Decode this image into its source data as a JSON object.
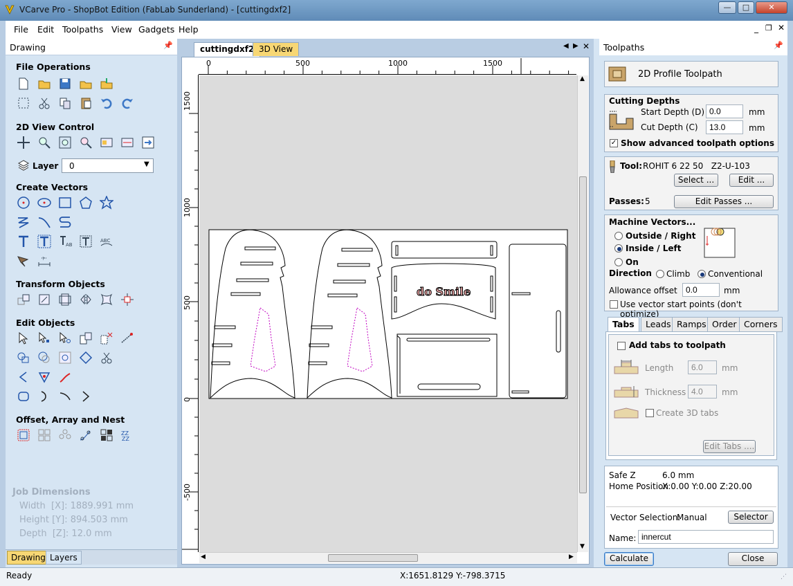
{
  "window": {
    "title": "VCarve Pro - ShopBot Edition (FabLab Sunderland) - [cuttingdxf2]"
  },
  "menu": [
    "File",
    "Edit",
    "Toolpaths",
    "View",
    "Gadgets",
    "Help"
  ],
  "left_panel": {
    "header": "Drawing",
    "sections": {
      "file_operations": "File Operations",
      "view_control": "2D View Control",
      "create_vectors": "Create Vectors",
      "transform_objects": "Transform Objects",
      "edit_objects": "Edit Objects",
      "offset_array_nest": "Offset, Array and Nest"
    },
    "layer": {
      "label": "Layer",
      "value": "0"
    },
    "job_dimensions": {
      "title": "Job Dimensions",
      "width": "Width  [X]: 1889.991 mm",
      "height": "Height [Y]: 894.503 mm",
      "depth": "Depth  [Z]: 12.0 mm"
    },
    "bottom_tabs": [
      "Drawing",
      "Layers"
    ]
  },
  "center": {
    "tabs": [
      "cuttingdxf2",
      "3D View"
    ],
    "ruler_top": [
      "0",
      "500",
      "1000",
      "1500"
    ],
    "ruler_left": [
      "1500",
      "1000",
      "500",
      "0",
      "-500"
    ],
    "design_text": "do Smile"
  },
  "right_panel": {
    "header": "Toolpaths",
    "toolpath_title": "2D Profile Toolpath",
    "cutting_depths": {
      "title": "Cutting Depths",
      "start_label": "Start Depth (D)",
      "start_value": "0.0",
      "cut_label": "Cut Depth (C)",
      "cut_value": "13.0",
      "unit": "mm",
      "advanced_label": "Show advanced toolpath options"
    },
    "tool": {
      "label": "Tool:",
      "name": "ROHIT 6 22 50   Z2-U-103",
      "select_btn": "Select ...",
      "edit_btn": "Edit ...",
      "passes_label": "Passes:",
      "passes_value": "5",
      "edit_passes_btn": "Edit Passes ..."
    },
    "machine_vectors": {
      "title": "Machine Vectors...",
      "outside": "Outside / Right",
      "inside": "Inside / Left",
      "on": "On",
      "direction_label": "Direction",
      "climb": "Climb",
      "conventional": "Conventional",
      "allowance_label": "Allowance offset",
      "allowance_value": "0.0",
      "allowance_unit": "mm",
      "start_points_label": "Use vector start points (don't optimize)"
    },
    "tabs": [
      "Tabs",
      "Leads",
      "Ramps",
      "Order",
      "Corners"
    ],
    "tabs_panel": {
      "add_tabs_label": "Add tabs to toolpath",
      "length_label": "Length",
      "length_value": "6.0",
      "thickness_label": "Thickness",
      "thickness_value": "4.0",
      "unit": "mm",
      "create_3d_label": "Create 3D tabs",
      "edit_tabs_btn": "Edit Tabs ...."
    },
    "safe_z": {
      "label": "Safe Z",
      "value": "6.0 mm"
    },
    "home": {
      "label": "Home Position",
      "value": "X:0.00 Y:0.00 Z:20.00"
    },
    "vector_selection": {
      "label": "Vector Selection:",
      "value": "Manual",
      "btn": "Selector ..."
    },
    "name": {
      "label": "Name:",
      "value": "innercut"
    },
    "calculate_btn": "Calculate",
    "close_btn": "Close"
  },
  "status": {
    "left": "Ready",
    "coords": "X:1651.8129 Y:-798.3715"
  },
  "colors": {
    "panel": "#d6e5f3",
    "frame": "#b9cde3",
    "accent_tab": "#f7d774",
    "toolpath_preview": "#c000c0"
  }
}
